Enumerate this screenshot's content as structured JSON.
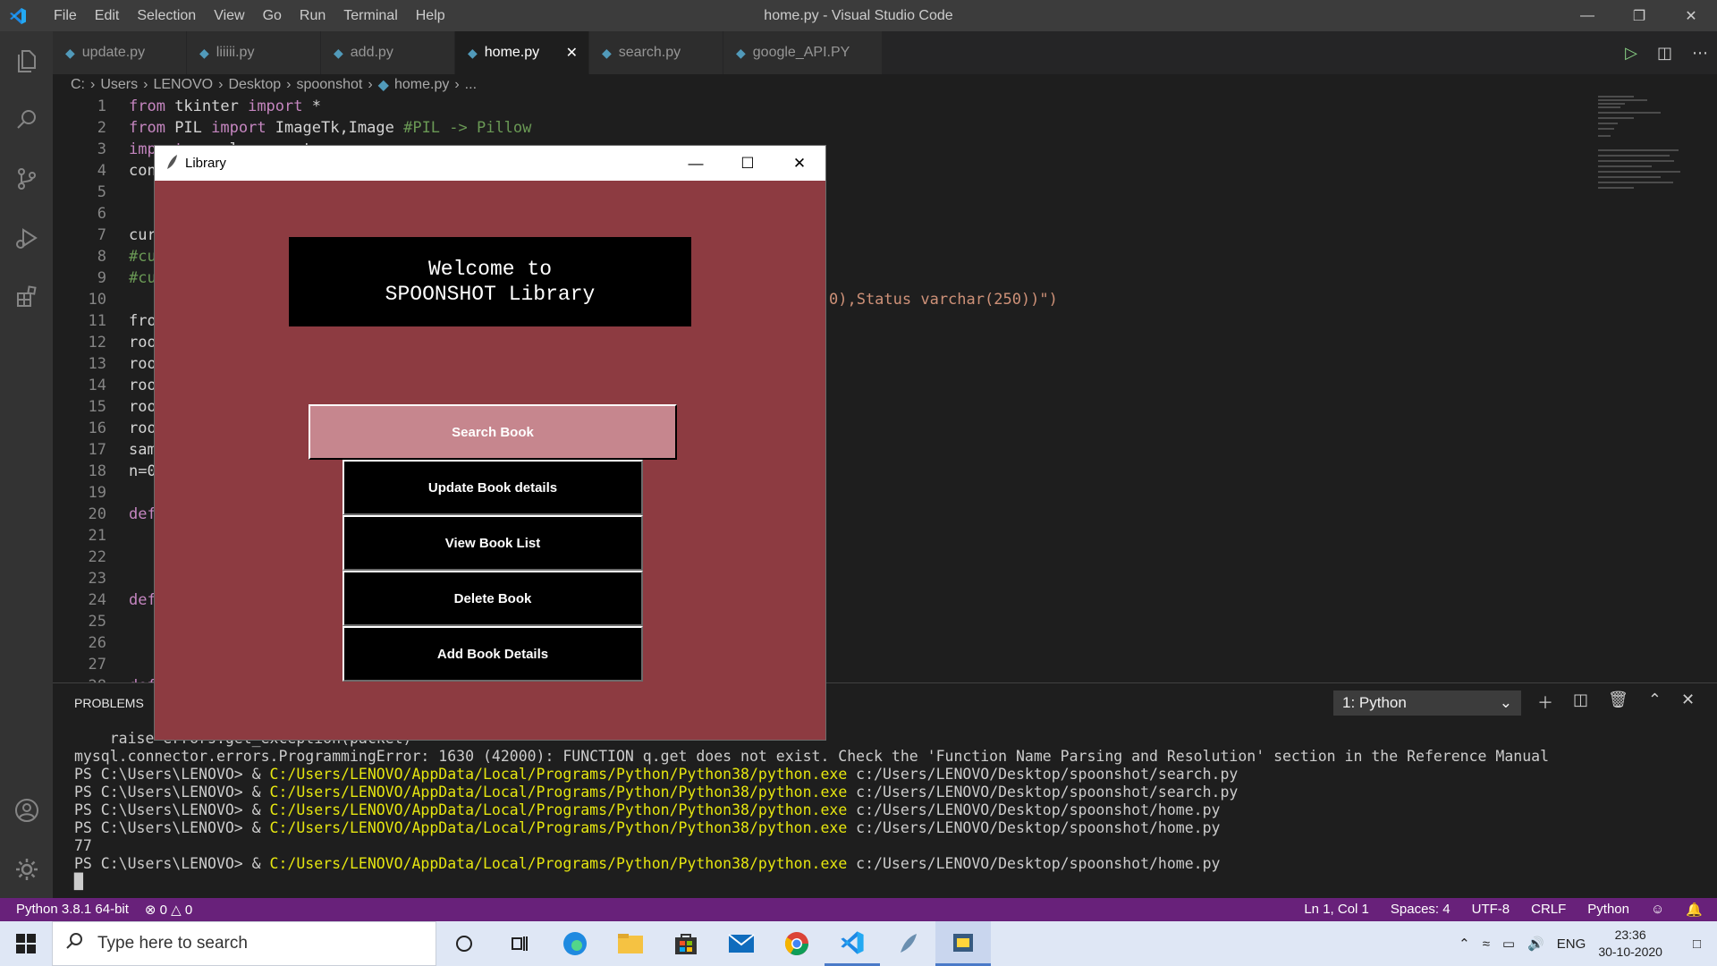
{
  "titlebar": {
    "menu": [
      "File",
      "Edit",
      "Selection",
      "View",
      "Go",
      "Run",
      "Terminal",
      "Help"
    ],
    "window_title": "home.py - Visual Studio Code"
  },
  "tabs": [
    {
      "label": "update.py",
      "active": false
    },
    {
      "label": "liiiii.py",
      "active": false
    },
    {
      "label": "add.py",
      "active": false
    },
    {
      "label": "home.py",
      "active": true
    },
    {
      "label": "search.py",
      "active": false
    },
    {
      "label": "google_API.PY",
      "active": false
    }
  ],
  "breadcrumb": [
    "C:",
    "Users",
    "LENOVO",
    "Desktop",
    "spoonshot",
    "home.py",
    "..."
  ],
  "editor": {
    "lines": [
      {
        "n": "1",
        "code": "from tkinter import *"
      },
      {
        "n": "2",
        "code": "from PIL import ImageTk,Image #PIL -> Pillow"
      },
      {
        "n": "3",
        "code": "import mysql.connector"
      },
      {
        "n": "4",
        "code": "con"
      },
      {
        "n": "5",
        "code": ""
      },
      {
        "n": "6",
        "code": ""
      },
      {
        "n": "7",
        "code": "cur"
      },
      {
        "n": "8",
        "code": "#cu"
      },
      {
        "n": "9",
        "code": "#cu"
      },
      {
        "n": "10",
        "code": ""
      },
      {
        "n": "11",
        "code": "fro"
      },
      {
        "n": "12",
        "code": "roo"
      },
      {
        "n": "13",
        "code": "roo"
      },
      {
        "n": "14",
        "code": "roo"
      },
      {
        "n": "15",
        "code": "roo"
      },
      {
        "n": "16",
        "code": "roo"
      },
      {
        "n": "17",
        "code": "sam"
      },
      {
        "n": "18",
        "code": "n=0"
      },
      {
        "n": "19",
        "code": ""
      },
      {
        "n": "20",
        "code": "def"
      },
      {
        "n": "21",
        "code": ""
      },
      {
        "n": "22",
        "code": ""
      },
      {
        "n": "23",
        "code": ""
      },
      {
        "n": "24",
        "code": "def"
      },
      {
        "n": "25",
        "code": ""
      },
      {
        "n": "26",
        "code": ""
      },
      {
        "n": "27",
        "code": ""
      },
      {
        "n": "28",
        "code": "def"
      }
    ],
    "line9_tail": "0),Status varchar(250))\")"
  },
  "panel": {
    "problems_label": "PROBLEMS",
    "terminal_select": "1: Python",
    "terminal_lines": [
      {
        "pre": "    raise errors.get_exception(packet)",
        "y": "",
        "post": ""
      },
      {
        "pre": "mysql.connector.errors.ProgrammingError: 1630 (42000): FUNCTION q.get does not exist. Check the 'Function Name Parsing and Resolution' section in the Reference Manual",
        "y": "",
        "post": ""
      },
      {
        "pre": "PS C:\\Users\\LENOVO> & ",
        "y": "C:/Users/LENOVO/AppData/Local/Programs/Python/Python38/python.exe",
        "post": " c:/Users/LENOVO/Desktop/spoonshot/search.py"
      },
      {
        "pre": "PS C:\\Users\\LENOVO> & ",
        "y": "C:/Users/LENOVO/AppData/Local/Programs/Python/Python38/python.exe",
        "post": " c:/Users/LENOVO/Desktop/spoonshot/search.py"
      },
      {
        "pre": "PS C:\\Users\\LENOVO> & ",
        "y": "C:/Users/LENOVO/AppData/Local/Programs/Python/Python38/python.exe",
        "post": " c:/Users/LENOVO/Desktop/spoonshot/home.py"
      },
      {
        "pre": "PS C:\\Users\\LENOVO> & ",
        "y": "C:/Users/LENOVO/AppData/Local/Programs/Python/Python38/python.exe",
        "post": " c:/Users/LENOVO/Desktop/spoonshot/home.py"
      },
      {
        "pre": "77",
        "y": "",
        "post": ""
      },
      {
        "pre": "PS C:\\Users\\LENOVO> & ",
        "y": "C:/Users/LENOVO/AppData/Local/Programs/Python/Python38/python.exe",
        "post": " c:/Users/LENOVO/Desktop/spoonshot/home.py"
      },
      {
        "pre": "█",
        "y": "",
        "post": ""
      }
    ]
  },
  "statusbar": {
    "python": "Python 3.8.1 64-bit",
    "errors": "0",
    "warnings": "0",
    "position": "Ln 1, Col 1",
    "spaces": "Spaces: 4",
    "encoding": "UTF-8",
    "eol": "CRLF",
    "language": "Python"
  },
  "taskbar": {
    "search_placeholder": "Type here to search",
    "lang": "ENG",
    "time": "23:36",
    "date": "30-10-2020"
  },
  "tkwindow": {
    "title": "Library",
    "welcome_line1": "Welcome to",
    "welcome_line2": "SPOONSHOT Library",
    "buttons": [
      "Search Book",
      "Update Book details",
      "View Book List",
      "Delete Book",
      "Add Book Details"
    ]
  },
  "colors": {
    "statusbar": "#68217a",
    "tk_background": "#8d3b41",
    "search_button": "#c6868e"
  }
}
